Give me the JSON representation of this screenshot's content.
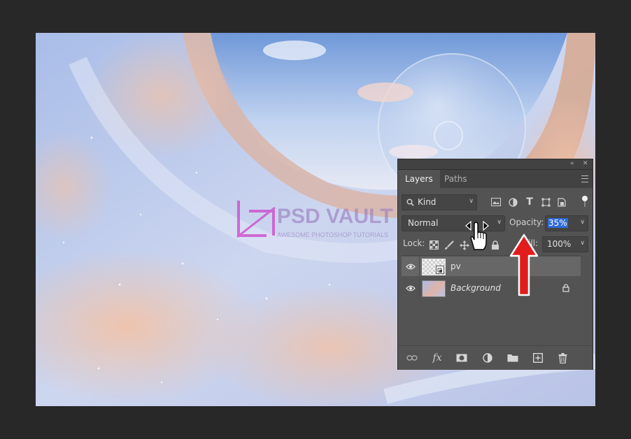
{
  "panel": {
    "tabs": [
      {
        "label": "Layers",
        "active": true
      },
      {
        "label": "Paths",
        "active": false
      }
    ],
    "filter": {
      "kind_label": "Kind"
    },
    "blend_mode": "Normal",
    "opacity": {
      "label": "Opacity:",
      "value": "35%"
    },
    "lock": {
      "label": "Lock:"
    },
    "fill": {
      "label": "Fill:",
      "value": "100%"
    },
    "layers": [
      {
        "name": "pv",
        "selected": true,
        "visible": true,
        "italic": false
      },
      {
        "name": "Background",
        "selected": false,
        "visible": true,
        "italic": true,
        "locked": true
      }
    ]
  },
  "colors": {
    "panel_bg": "#535353",
    "selected_row": "#676767",
    "highlight": "#2e6bd6",
    "arrow": "#e21c1c",
    "watermark": "#cc44cc"
  }
}
